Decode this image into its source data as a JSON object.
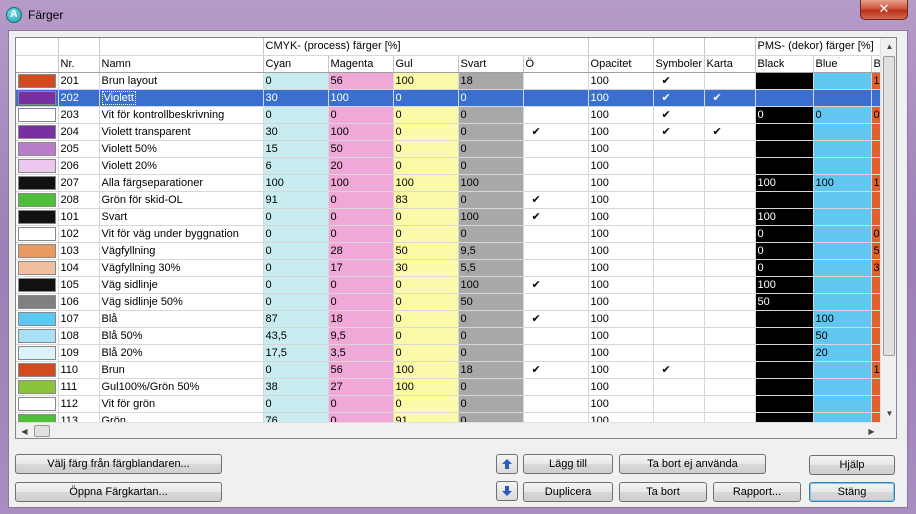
{
  "window": {
    "title": "Färger",
    "close_glyph": "✕"
  },
  "grid": {
    "group_headers": {
      "cmyk": "CMYK- (process) färger [%]",
      "pms": "PMS- (dekor) färger [%]"
    },
    "columns": [
      "",
      "Nr.",
      "Namn",
      "Cyan",
      "Magenta",
      "Gul",
      "Svart",
      "Ö",
      "Opacitet",
      "Symboler",
      "Karta",
      "Black",
      "Blue",
      "B"
    ],
    "rows": [
      {
        "swatch": "#d24a1e",
        "nr": "201",
        "name": "Brun layout",
        "c": "0",
        "m": "56",
        "y": "100",
        "k": "18",
        "o": "",
        "op": "100",
        "sym": "✔",
        "map": "",
        "pb": "",
        "pbl": "",
        "pbr": "1"
      },
      {
        "swatch": "#7a2fa0",
        "nr": "202",
        "name": "Violett",
        "c": "30",
        "m": "100",
        "y": "0",
        "k": "0",
        "o": "",
        "op": "100",
        "sym": "✔",
        "map": "✔",
        "pb": "",
        "pbl": "",
        "pbr": "",
        "selected": true
      },
      {
        "swatch": "#ffffff",
        "nr": "203",
        "name": "Vit för kontrollbeskrivning",
        "c": "0",
        "m": "0",
        "y": "0",
        "k": "0",
        "o": "",
        "op": "100",
        "sym": "✔",
        "map": "",
        "pb": "0",
        "pbl": "0",
        "pbr": "0"
      },
      {
        "swatch": "#7a2fa0",
        "nr": "204",
        "name": "Violett transparent",
        "c": "30",
        "m": "100",
        "y": "0",
        "k": "0",
        "o": "✔",
        "op": "100",
        "sym": "✔",
        "map": "✔",
        "pb": "",
        "pbl": "",
        "pbr": ""
      },
      {
        "swatch": "#b87ec8",
        "nr": "205",
        "name": "Violett 50%",
        "c": "15",
        "m": "50",
        "y": "0",
        "k": "0",
        "o": "",
        "op": "100",
        "sym": "",
        "map": "",
        "pb": "",
        "pbl": "",
        "pbr": ""
      },
      {
        "swatch": "#ecc8ee",
        "nr": "206",
        "name": "Violett 20%",
        "c": "6",
        "m": "20",
        "y": "0",
        "k": "0",
        "o": "",
        "op": "100",
        "sym": "",
        "map": "",
        "pb": "",
        "pbl": "",
        "pbr": ""
      },
      {
        "swatch": "#111111",
        "nr": "207",
        "name": "Alla färgseparationer",
        "c": "100",
        "m": "100",
        "y": "100",
        "k": "100",
        "o": "",
        "op": "100",
        "sym": "",
        "map": "",
        "pb": "100",
        "pbl": "100",
        "pbr": "1"
      },
      {
        "swatch": "#4fbf3a",
        "nr": "208",
        "name": "Grön för skid-OL",
        "c": "91",
        "m": "0",
        "y": "83",
        "k": "0",
        "o": "✔",
        "op": "100",
        "sym": "",
        "map": "",
        "pb": "",
        "pbl": "",
        "pbr": ""
      },
      {
        "swatch": "#111111",
        "nr": "101",
        "name": "Svart",
        "c": "0",
        "m": "0",
        "y": "0",
        "k": "100",
        "o": "✔",
        "op": "100",
        "sym": "",
        "map": "",
        "pb": "100",
        "pbl": "",
        "pbr": ""
      },
      {
        "swatch": "#ffffff",
        "nr": "102",
        "name": "Vit för väg under byggnation",
        "c": "0",
        "m": "0",
        "y": "0",
        "k": "0",
        "o": "",
        "op": "100",
        "sym": "",
        "map": "",
        "pb": "0",
        "pbl": "",
        "pbr": "0"
      },
      {
        "swatch": "#e89a60",
        "nr": "103",
        "name": "Vägfyllning",
        "c": "0",
        "m": "28",
        "y": "50",
        "k": "9,5",
        "o": "",
        "op": "100",
        "sym": "",
        "map": "",
        "pb": "0",
        "pbl": "",
        "pbr": "5"
      },
      {
        "swatch": "#f2c0a0",
        "nr": "104",
        "name": "Vägfyllning 30%",
        "c": "0",
        "m": "17",
        "y": "30",
        "k": "5,5",
        "o": "",
        "op": "100",
        "sym": "",
        "map": "",
        "pb": "0",
        "pbl": "",
        "pbr": "3"
      },
      {
        "swatch": "#111111",
        "nr": "105",
        "name": "Väg sidlinje",
        "c": "0",
        "m": "0",
        "y": "0",
        "k": "100",
        "o": "✔",
        "op": "100",
        "sym": "",
        "map": "",
        "pb": "100",
        "pbl": "",
        "pbr": ""
      },
      {
        "swatch": "#808080",
        "nr": "106",
        "name": "Väg sidlinje 50%",
        "c": "0",
        "m": "0",
        "y": "0",
        "k": "50",
        "o": "",
        "op": "100",
        "sym": "",
        "map": "",
        "pb": "50",
        "pbl": "",
        "pbr": ""
      },
      {
        "swatch": "#5ac8f0",
        "nr": "107",
        "name": "Blå",
        "c": "87",
        "m": "18",
        "y": "0",
        "k": "0",
        "o": "✔",
        "op": "100",
        "sym": "",
        "map": "",
        "pb": "",
        "pbl": "100",
        "pbr": ""
      },
      {
        "swatch": "#aae0f6",
        "nr": "108",
        "name": "Blå 50%",
        "c": "43,5",
        "m": "9,5",
        "y": "0",
        "k": "0",
        "o": "",
        "op": "100",
        "sym": "",
        "map": "",
        "pb": "",
        "pbl": "50",
        "pbr": ""
      },
      {
        "swatch": "#dcf2fb",
        "nr": "109",
        "name": "Blå 20%",
        "c": "17,5",
        "m": "3,5",
        "y": "0",
        "k": "0",
        "o": "",
        "op": "100",
        "sym": "",
        "map": "",
        "pb": "",
        "pbl": "20",
        "pbr": ""
      },
      {
        "swatch": "#d24a1e",
        "nr": "110",
        "name": "Brun",
        "c": "0",
        "m": "56",
        "y": "100",
        "k": "18",
        "o": "✔",
        "op": "100",
        "sym": "✔",
        "map": "",
        "pb": "",
        "pbl": "",
        "pbr": "1"
      },
      {
        "swatch": "#8ac43a",
        "nr": "111",
        "name": "Gul100%/Grön 50%",
        "c": "38",
        "m": "27",
        "y": "100",
        "k": "0",
        "o": "",
        "op": "100",
        "sym": "",
        "map": "",
        "pb": "",
        "pbl": "",
        "pbr": ""
      },
      {
        "swatch": "#ffffff",
        "nr": "112",
        "name": "Vit för grön",
        "c": "0",
        "m": "0",
        "y": "0",
        "k": "0",
        "o": "",
        "op": "100",
        "sym": "",
        "map": "",
        "pb": "",
        "pbl": "",
        "pbr": ""
      },
      {
        "swatch": "#4fbf3a",
        "nr": "113",
        "name": "Grön",
        "c": "76",
        "m": "0",
        "y": "91",
        "k": "0",
        "o": "",
        "op": "100",
        "sym": "",
        "map": "",
        "pb": "",
        "pbl": "",
        "pbr": ""
      }
    ]
  },
  "buttons": {
    "pick_from_mixer": "Välj färg från färgblandaren...",
    "open_color_map": "Öppna Färgkartan...",
    "add": "Lägg till",
    "duplicate": "Duplicera",
    "remove_unused": "Ta bort ej använda",
    "remove": "Ta bort",
    "report": "Rapport...",
    "help": "Hjälp",
    "close": "Stäng"
  },
  "colors": {
    "cyan_col": "#c8ecf0",
    "magenta_col": "#f0a8d8",
    "yellow_col": "#fafaa8",
    "black_col": "#a8a8a8",
    "selection": "#3a6fd0",
    "pms_black": "#000000",
    "pms_blue": "#60c8f0"
  },
  "icons": [
    "app-icon",
    "close-icon",
    "move-up-icon",
    "move-down-icon",
    "check-icon"
  ]
}
